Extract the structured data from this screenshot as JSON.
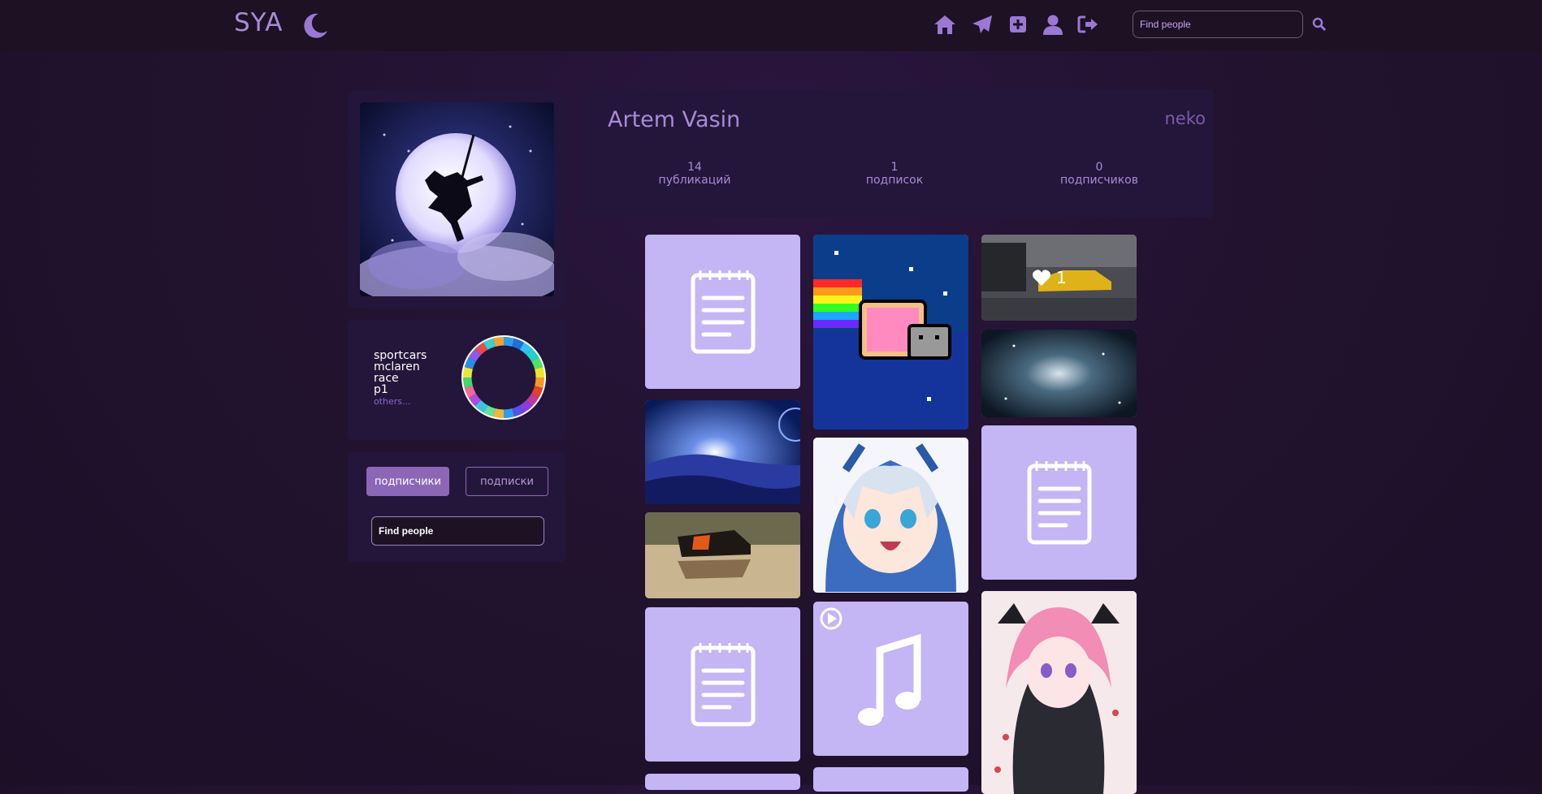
{
  "header": {
    "logo": "SYA",
    "nav": [
      "home-icon",
      "send-icon",
      "add-post-icon",
      "user-icon",
      "logout-icon"
    ],
    "search_placeholder": "Find people"
  },
  "profile": {
    "name": "Artem Vasin",
    "nickname": "neko",
    "stats": [
      {
        "num": "14",
        "label": "публикаций"
      },
      {
        "num": "1",
        "label": "подписок"
      },
      {
        "num": "0",
        "label": "подписчиков"
      }
    ]
  },
  "tags": {
    "items": [
      "sportcars",
      "mclaren",
      "race",
      "p1"
    ],
    "others": "others..."
  },
  "follow": {
    "followers_label": "подписчики",
    "following_label": "подписки",
    "search_placeholder": "Find people"
  },
  "posts": {
    "like_count": "1"
  },
  "colors": {
    "accent": "#a98ad8",
    "button": "#8c67b8",
    "tile": "#c4b5f5",
    "background": "#22122f"
  }
}
